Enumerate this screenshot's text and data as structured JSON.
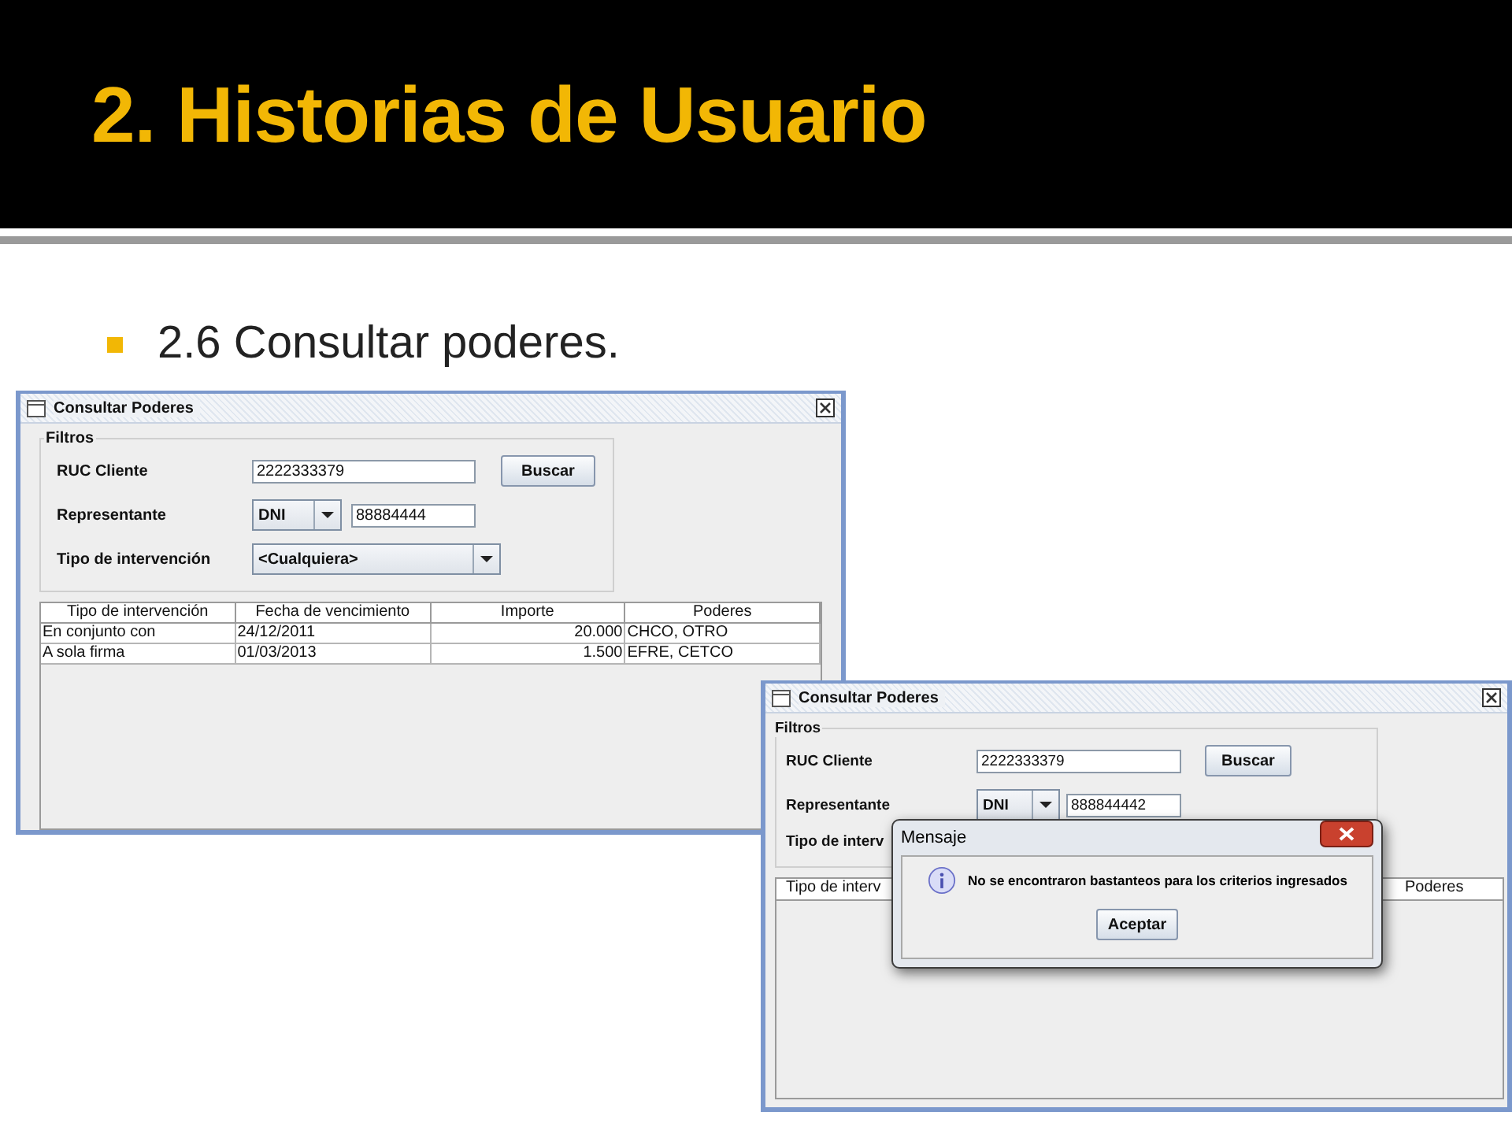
{
  "slide_title": "2. Historias de Usuario",
  "bullets": [
    "2.6 Consultar poderes."
  ],
  "windows": [
    {
      "title": "Consultar Poderes",
      "group_title": "Filtros",
      "ruc_label": "RUC Cliente",
      "ruc_value": "2222333379",
      "search_button": "Buscar",
      "rep_label": "Representante",
      "doc_type": "DNI",
      "doc_value": "88884444",
      "tipo_label": "Tipo de intervención",
      "tipo_value": "<Cualquiera>",
      "table": {
        "columns": [
          "Tipo de intervención",
          "Fecha de vencimiento",
          "Importe",
          "Poderes"
        ],
        "rows": [
          [
            "En conjunto con",
            "24/12/2011",
            "20.000",
            "CHCO, OTRO"
          ],
          [
            "A sola firma",
            "01/03/2013",
            "1.500",
            "EFRE, CETCO"
          ]
        ]
      }
    },
    {
      "title": "Consultar Poderes",
      "group_title": "Filtros",
      "ruc_label": "RUC Cliente",
      "ruc_value": "2222333379",
      "search_button": "Buscar",
      "rep_label": "Representante",
      "doc_type": "DNI",
      "doc_value": "888844442",
      "tipo_label": "Tipo de interv",
      "table": {
        "columns": [
          "Tipo de interv",
          "Poderes"
        ]
      }
    }
  ],
  "dialog": {
    "title": "Mensaje",
    "message": "No se encontraron bastanteos para los criterios ingresados",
    "button": "Aceptar"
  }
}
